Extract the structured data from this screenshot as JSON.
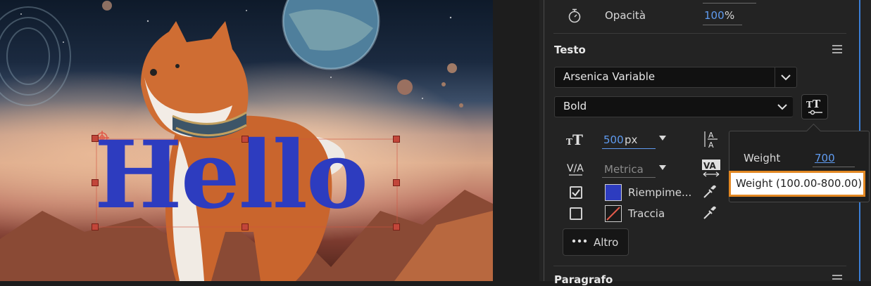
{
  "canvas": {
    "text_layer": "Hello",
    "text_color": "#2d3cbf"
  },
  "panel": {
    "opacity": {
      "label": "Opacità",
      "value": "100",
      "unit": "%"
    },
    "text_section": {
      "title": "Testo",
      "font_family": "Arsenica Variable",
      "font_style": "Bold",
      "font_size": {
        "value": "500",
        "unit": "px"
      },
      "kerning": "Metrica",
      "fill": {
        "label": "Riempime...",
        "checked": true,
        "color": "#2d3cbf"
      },
      "stroke": {
        "label": "Traccia",
        "checked": false
      },
      "more_button": "Altro"
    },
    "paragraph_section": {
      "title": "Paragrafo"
    }
  },
  "weight_popup": {
    "label": "Weight",
    "value": "700",
    "tooltip": "Weight (100.00-800.00)"
  },
  "colors": {
    "accent_blue": "#5f9bf0",
    "highlight_orange": "#e28722",
    "panel_bg": "#232323"
  }
}
